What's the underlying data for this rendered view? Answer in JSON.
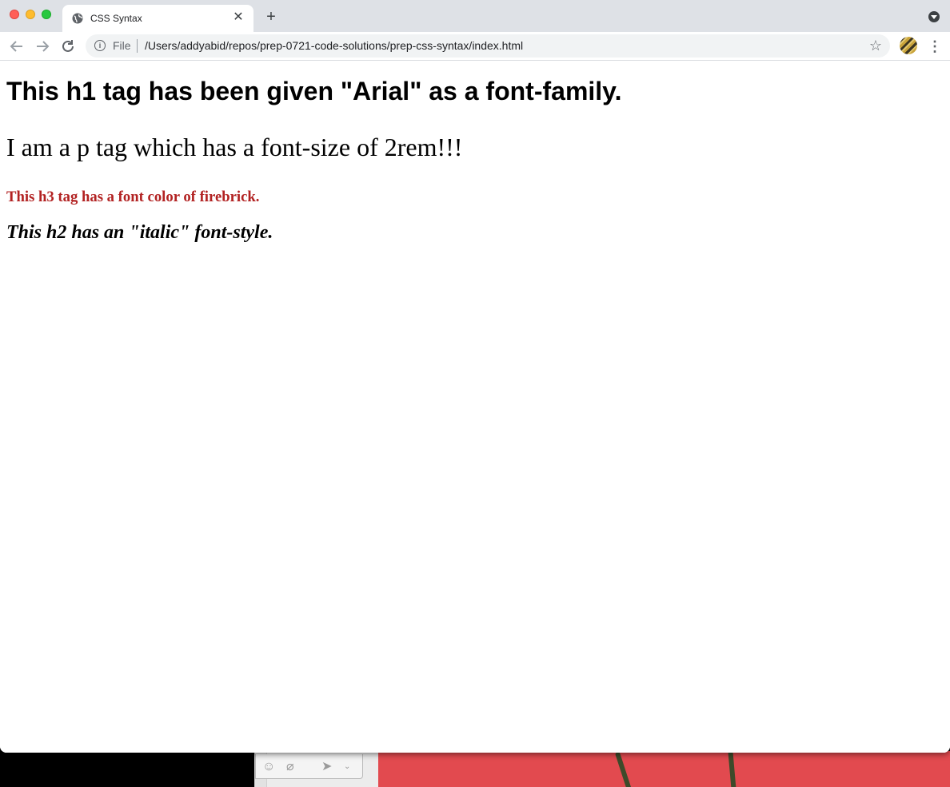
{
  "browser": {
    "tab_title": "CSS Syntax",
    "new_tab_label": "+",
    "tab_close_label": "✕",
    "address": {
      "scheme_label": "File",
      "url": "/Users/addyabid/repos/prep-0721-code-solutions/prep-css-syntax/index.html"
    },
    "icons": [
      "back-arrow-icon",
      "forward-arrow-icon",
      "reload-icon",
      "info-icon",
      "star-icon",
      "avatar",
      "more-vert-icon",
      "globe-icon",
      "tab-search-icon"
    ]
  },
  "page": {
    "h1": "This h1 tag has been given \"Arial\" as a font-family.",
    "p": "I am a p tag which has a font-size of 2rem!!!",
    "h3": "This h3 tag has a font color of firebrick.",
    "h2": "This h2 has an \"italic\" font-style."
  },
  "colors": {
    "h3_color": "#b22222",
    "tabbar_bg": "#dee1e6",
    "desktop_red": "#e24a4f"
  }
}
